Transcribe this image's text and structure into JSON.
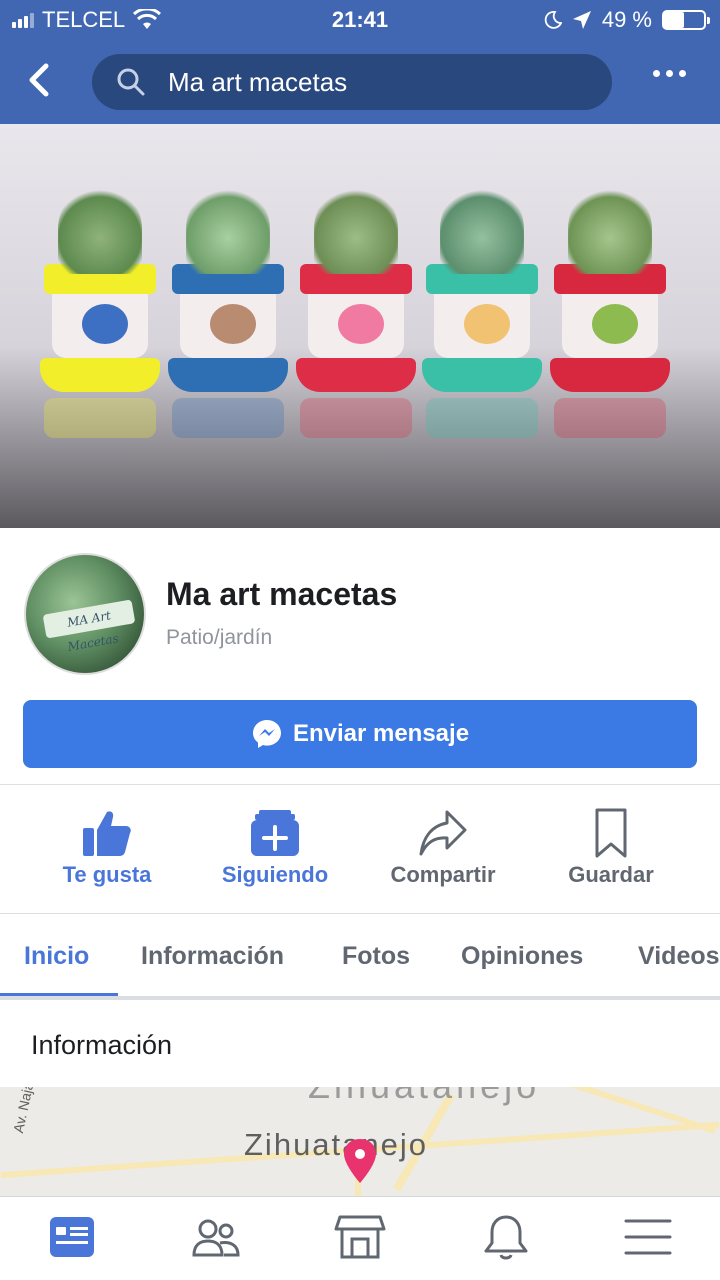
{
  "status_bar": {
    "carrier": "TELCEL",
    "time": "21:41",
    "battery_percent": "49 %",
    "battery_level": 0.49
  },
  "nav": {
    "back_icon": "chevron-left-icon",
    "search_query": "Ma art macetas",
    "more_icon": "more-dots-icon"
  },
  "profile": {
    "page_name": "Ma art macetas",
    "category": "Patio/jardín",
    "avatar_banner_text": "MA Art Macetas"
  },
  "message_button": {
    "label": "Enviar mensaje",
    "icon": "messenger-icon"
  },
  "actions": [
    {
      "label": "Te gusta",
      "icon": "thumbs-up-icon",
      "active": true
    },
    {
      "label": "Siguiendo",
      "icon": "follow-feed-icon",
      "active": true
    },
    {
      "label": "Compartir",
      "icon": "share-arrow-icon",
      "active": false
    },
    {
      "label": "Guardar",
      "icon": "bookmark-icon",
      "active": false
    }
  ],
  "tabs": [
    {
      "label": "Inicio",
      "active": true
    },
    {
      "label": "Información",
      "active": false
    },
    {
      "label": "Fotos",
      "active": false
    },
    {
      "label": "Opiniones",
      "active": false
    },
    {
      "label": "Videos",
      "active": false
    }
  ],
  "section": {
    "title": "Información"
  },
  "map": {
    "city_label": "Zihuatanejo",
    "street_label": "Av. Najahua",
    "pin_icon": "location-pin-icon"
  },
  "bottom_nav": [
    {
      "icon": "news-feed-icon",
      "active": true
    },
    {
      "icon": "friends-icon",
      "active": false
    },
    {
      "icon": "marketplace-icon",
      "active": false
    },
    {
      "icon": "notifications-bell-icon",
      "active": false
    },
    {
      "icon": "menu-icon",
      "active": false
    }
  ],
  "colors": {
    "brand_blue": "#4267b2",
    "action_blue": "#4a76d9",
    "button_blue": "#3b7ae4",
    "map_pin": "#e8336e"
  }
}
